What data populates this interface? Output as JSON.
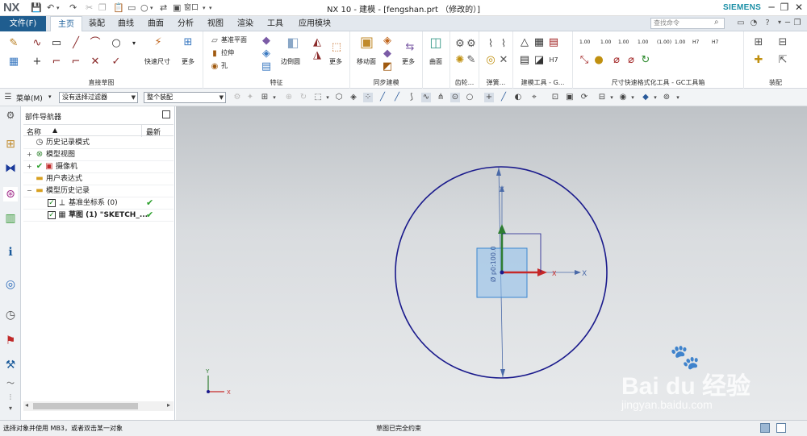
{
  "app": {
    "logo": "NX",
    "title": "NX 10 - 建模 - [fengshan.prt （修改的）]",
    "brand": "SIEMENS"
  },
  "quick_access": {
    "window_label": "窗口"
  },
  "menu": {
    "file": "文件(F)",
    "tabs": [
      "主页",
      "装配",
      "曲线",
      "曲面",
      "分析",
      "视图",
      "渲染",
      "工具",
      "应用模块"
    ],
    "search_placeholder": "查找命令"
  },
  "ribbon": {
    "groups": [
      {
        "label": "直接草图"
      },
      {
        "label": "特征"
      },
      {
        "label": "同步建模"
      },
      {
        "label": "齿轮..."
      },
      {
        "label": "弹簧..."
      },
      {
        "label": "建模工具 - G..."
      },
      {
        "label": "尺寸快速格式化工具 - GC工具箱"
      },
      {
        "label": "装配"
      }
    ],
    "buttons": {
      "quick_dimension": "快速尺寸",
      "more1": "更多",
      "datum_plane": "基准平面",
      "extrude": "拉伸",
      "hole": "孔",
      "edge_blend": "边倒圆",
      "more2": "更多",
      "move_face": "移动面",
      "more3": "更多",
      "surface": "曲面"
    },
    "dim_labels": [
      "1.00",
      "1.00",
      "1.00",
      "1.00",
      "(1.00)",
      "1.00",
      "H7",
      "H7"
    ]
  },
  "selection_bar": {
    "menu": "菜单(M)",
    "filter": "没有选择过滤器",
    "scope": "整个装配"
  },
  "part_navigator": {
    "title": "部件导航器",
    "col_name": "名称",
    "col_latest": "最新",
    "nodes": [
      {
        "label": "历史记录模式",
        "latest": ""
      },
      {
        "label": "模型视图",
        "latest": ""
      },
      {
        "label": "摄像机",
        "latest": ""
      },
      {
        "label": "用户表达式",
        "latest": ""
      },
      {
        "label": "模型历史记录",
        "latest": ""
      },
      {
        "label": "基准坐标系 (0)",
        "latest": "✔"
      },
      {
        "label": "草图 (1) \"SKETCH_...",
        "latest": "✔"
      }
    ]
  },
  "viewport": {
    "axis_x": "X",
    "axis_y": "Y",
    "sketch_x": "X",
    "dimension_label": "Ø p0:100.0",
    "triad_x": "X",
    "triad_y": "Y",
    "colors": {
      "sketch_circle": "#1a1a8c",
      "y_axis": "#2e7d32",
      "x_axis": "#c62828",
      "csys_box": "#62a6e0"
    }
  },
  "status": {
    "left": "选择对象并使用 MB3，或者双击某一对象",
    "center": "草图已完全约束"
  },
  "watermark": {
    "text": "Bai du 经验",
    "url": "jingyan.baidu.com"
  }
}
